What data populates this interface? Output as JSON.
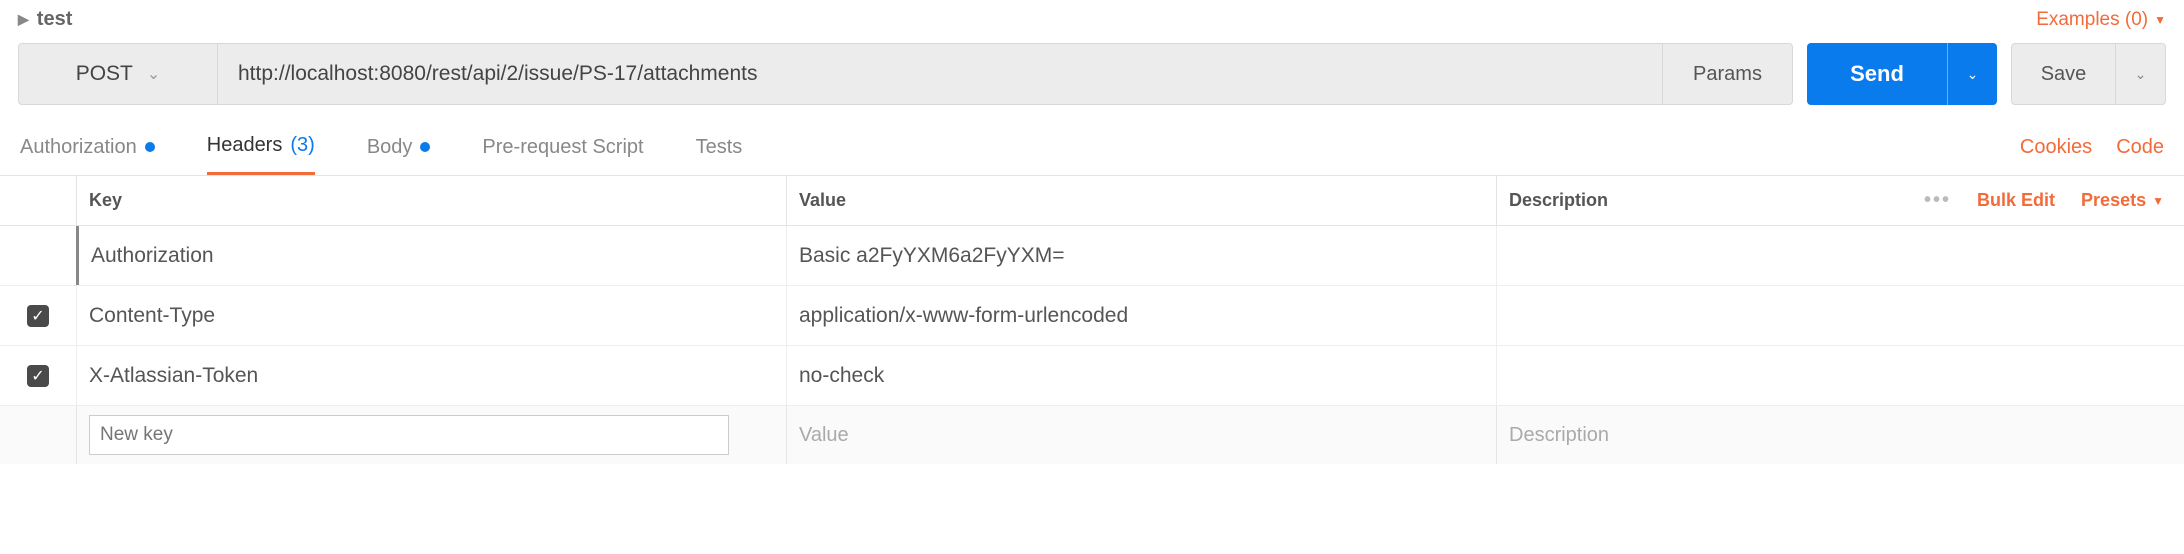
{
  "breadcrumb": {
    "title": "test"
  },
  "examples": {
    "label": "Examples (0)"
  },
  "request": {
    "method": "POST",
    "url": "http://localhost:8080/rest/api/2/issue/PS-17/attachments",
    "params_label": "Params",
    "send_label": "Send",
    "save_label": "Save"
  },
  "tabs": {
    "authorization": "Authorization",
    "headers": "Headers",
    "headers_count": "(3)",
    "body": "Body",
    "prerequest": "Pre-request Script",
    "tests": "Tests"
  },
  "right_links": {
    "cookies": "Cookies",
    "code": "Code"
  },
  "table": {
    "columns": {
      "key": "Key",
      "value": "Value",
      "description": "Description"
    },
    "bulk_edit": "Bulk Edit",
    "presets": "Presets",
    "rows": [
      {
        "key": "Authorization",
        "value": "Basic a2FyYXM6a2FyYXM=",
        "checked": false,
        "highlighted": true
      },
      {
        "key": "Content-Type",
        "value": "application/x-www-form-urlencoded",
        "checked": true,
        "highlighted": false
      },
      {
        "key": "X-Atlassian-Token",
        "value": "no-check",
        "checked": true,
        "highlighted": false
      }
    ],
    "new_row": {
      "key_placeholder": "New key",
      "value_placeholder": "Value",
      "desc_placeholder": "Description"
    }
  }
}
